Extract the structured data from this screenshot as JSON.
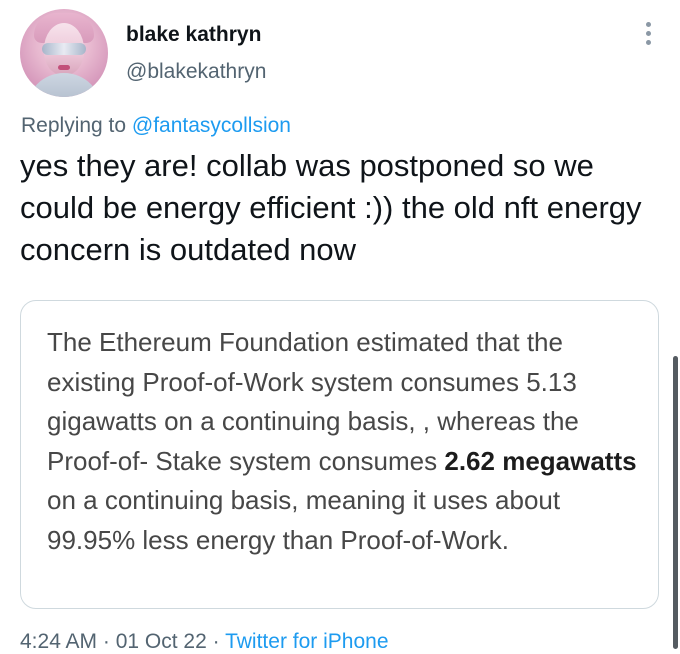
{
  "author": {
    "name": "blake kathryn",
    "handle": "@blakekathryn"
  },
  "reply": {
    "prefix": "Replying to ",
    "to": "@fantasycollsion"
  },
  "tweet": {
    "text": "yes they are! collab was postponed so we could be energy efficient :)) the old nft energy concern is outdated now"
  },
  "quote_card": {
    "line_pre": "The Ethereum Foundation estimated that the existing Proof-of-Work system consumes 5.13 gigawatts on a continuing basis, , whereas the Proof-of- Stake system consumes ",
    "bold": "2.62 megawatts",
    "line_post": " on a continuing basis, meaning it uses about 99.95% less energy than Proof-of-Work."
  },
  "meta": {
    "time": "4:24 AM",
    "separator1": " · ",
    "date": "01 Oct 22",
    "separator2": " · ",
    "source": "Twitter for iPhone"
  },
  "icons": {
    "more": "more-vertical-icon"
  }
}
